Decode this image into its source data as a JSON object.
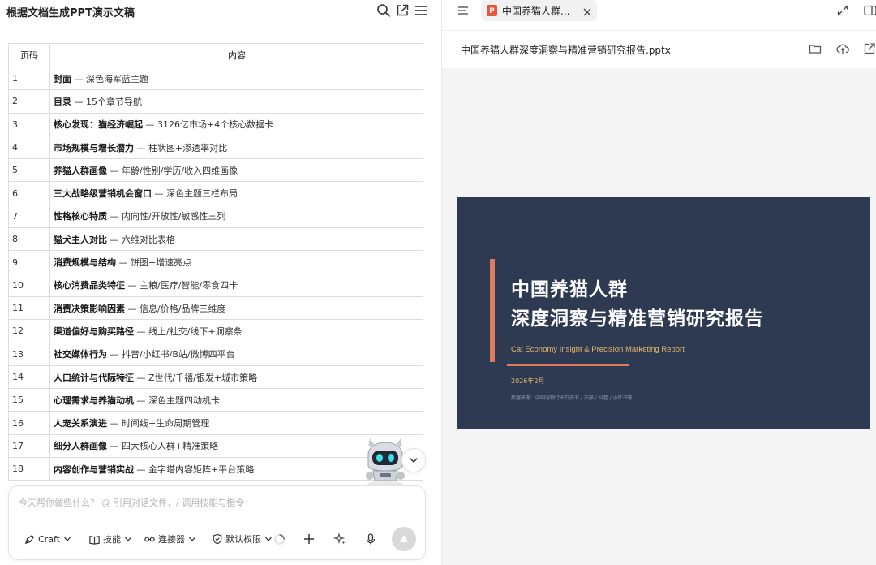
{
  "left": {
    "title": "根据文档生成PPT演示文稿",
    "icons": [
      "search-icon",
      "share-icon",
      "menu-icon"
    ]
  },
  "table": {
    "headers": [
      "页码",
      "内容"
    ],
    "rows": [
      {
        "page": "1",
        "bold": "封面",
        "desc": " — 深色海军蓝主题"
      },
      {
        "page": "2",
        "bold": "目录",
        "desc": " — 15个章节导航"
      },
      {
        "page": "3",
        "bold": "核心发现：猫经济崛起",
        "desc": " — 3126亿市场+4个核心数据卡"
      },
      {
        "page": "4",
        "bold": "市场规模与增长潜力",
        "desc": " — 柱状图+渗透率对比"
      },
      {
        "page": "5",
        "bold": "养猫人群画像",
        "desc": " — 年龄/性别/学历/收入四维画像"
      },
      {
        "page": "6",
        "bold": "三大战略级营销机会窗口",
        "desc": " — 深色主题三栏布局"
      },
      {
        "page": "7",
        "bold": "性格核心特质",
        "desc": " — 内向性/开放性/敏感性三列"
      },
      {
        "page": "8",
        "bold": "猫犬主人对比",
        "desc": " — 六维对比表格"
      },
      {
        "page": "9",
        "bold": "消费规模与结构",
        "desc": " — 饼图+增速亮点"
      },
      {
        "page": "10",
        "bold": "核心消费品类特征",
        "desc": " — 主粮/医疗/智能/零食四卡"
      },
      {
        "page": "11",
        "bold": "消费决策影响因素",
        "desc": " — 信息/价格/品牌三维度"
      },
      {
        "page": "12",
        "bold": "渠道偏好与购买路径",
        "desc": " — 线上/社交/线下+洞察条"
      },
      {
        "page": "13",
        "bold": "社交媒体行为",
        "desc": " — 抖音/小红书/B站/微博四平台"
      },
      {
        "page": "14",
        "bold": "人口统计与代际特征",
        "desc": " — Z世代/千禧/银发+城市策略"
      },
      {
        "page": "15",
        "bold": "心理需求与养猫动机",
        "desc": " — 深色主题四动机卡"
      },
      {
        "page": "16",
        "bold": "人宠关系演进",
        "desc": " — 时间线+生命周期管理"
      },
      {
        "page": "17",
        "bold": "细分人群画像",
        "desc": " — 四大核心人群+精准策略"
      },
      {
        "page": "18",
        "bold": "内容创作与营销实战",
        "desc": " — 金字塔内容矩阵+平台策略"
      }
    ]
  },
  "composer": {
    "placeholder": "今天帮你做些什么？ @ 引用对话文件，/ 调用技能与指令",
    "tools": {
      "craft": "Craft",
      "skills": "技能",
      "connectors": "连接器",
      "permission": "默认权限"
    }
  },
  "right": {
    "tab_label": "中国养猫人群...",
    "tab_badge": "P",
    "file_name": "中国养猫人群深度洞察与精准营销研究报告.pptx"
  },
  "slide": {
    "title_line1": "中国养猫人群",
    "title_line2": "深度洞察与精准营销研究报告",
    "subtitle": "Cat Economy Insight & Precision Marketing Report",
    "date": "2026年2月",
    "source": "数据来源：中国宠物行业白皮书 / 天猫 / 抖音 / 小红书等",
    "bg_color": "#2d3a52",
    "accent_color": "#e07a5f",
    "gold_color": "#e6b86a"
  }
}
